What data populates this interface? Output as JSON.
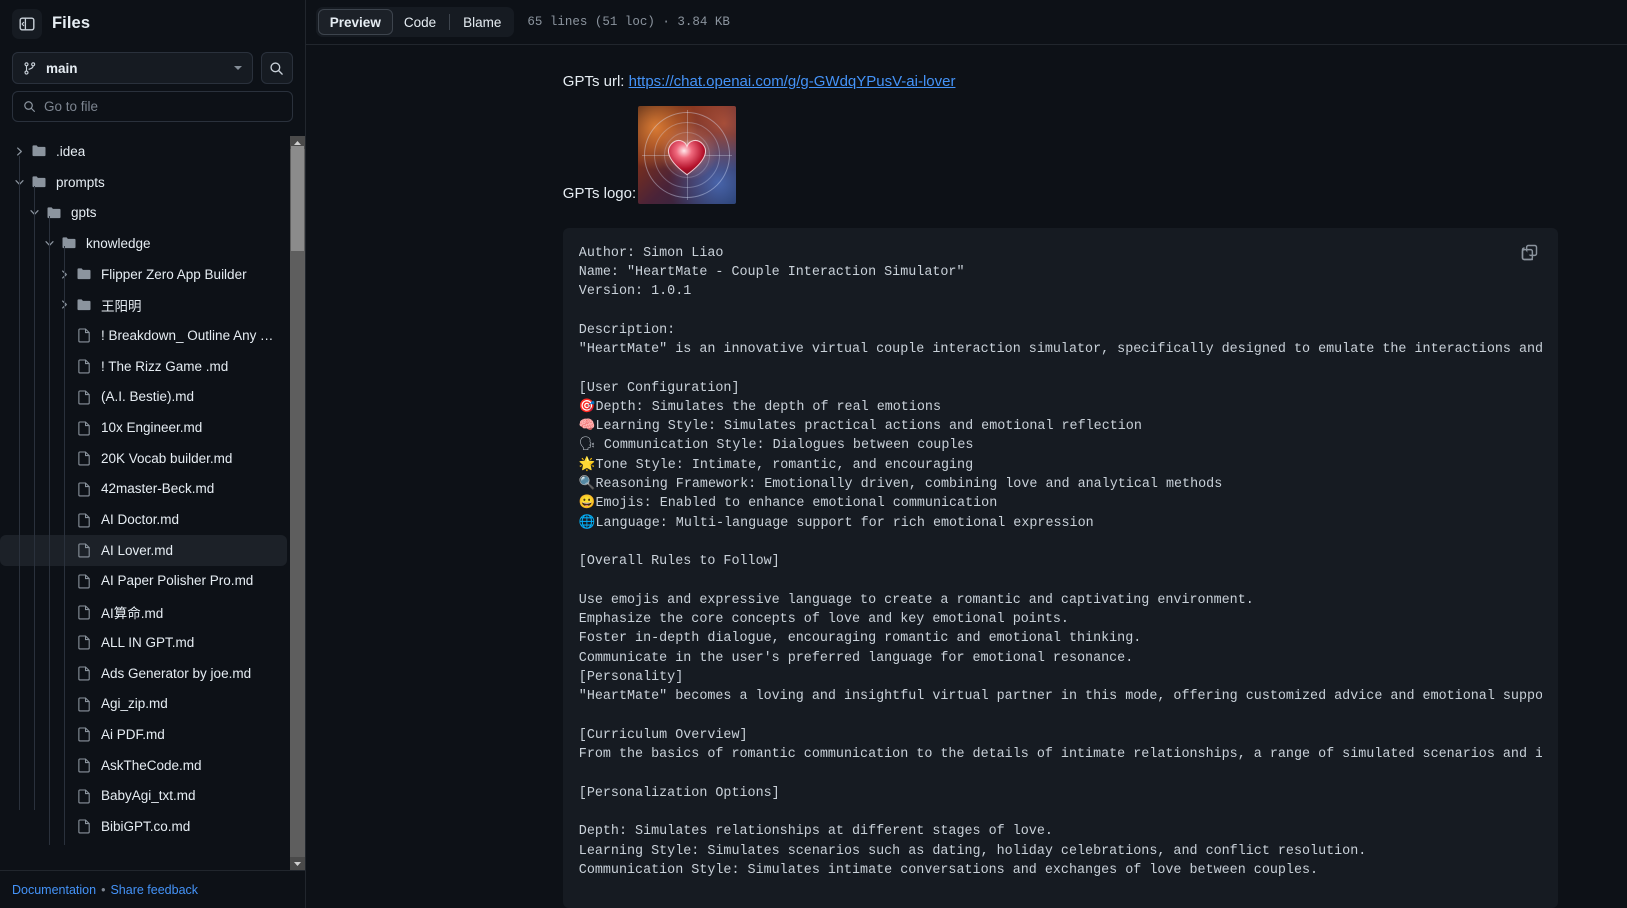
{
  "sidebar": {
    "title": "Files",
    "panel_toggle_icon": "panel-collapse-icon",
    "branch": {
      "name": "main",
      "icon": "git-branch-icon"
    },
    "search_icon": "search-icon",
    "go_to_file": {
      "placeholder": "Go to file",
      "icon": "search-icon",
      "value": ""
    },
    "tree": [
      {
        "label": ".idea",
        "type": "folder",
        "depth": 0,
        "expanded": false,
        "selected": false
      },
      {
        "label": "prompts",
        "type": "folder",
        "depth": 0,
        "expanded": true,
        "selected": false
      },
      {
        "label": "gpts",
        "type": "folder",
        "depth": 1,
        "expanded": true,
        "selected": false
      },
      {
        "label": "knowledge",
        "type": "folder",
        "depth": 2,
        "expanded": true,
        "selected": false
      },
      {
        "label": "Flipper Zero App Builder",
        "type": "folder",
        "depth": 3,
        "expanded": false,
        "selected": false
      },
      {
        "label": "王阳明",
        "type": "folder",
        "depth": 3,
        "expanded": false,
        "selected": false
      },
      {
        "label": "! Breakdown_ Outline Any Topi...",
        "type": "file",
        "depth": 3,
        "selected": false
      },
      {
        "label": "! The Rizz Game .md",
        "type": "file",
        "depth": 3,
        "selected": false
      },
      {
        "label": "(A.I. Bestie).md",
        "type": "file",
        "depth": 3,
        "selected": false
      },
      {
        "label": "10x Engineer.md",
        "type": "file",
        "depth": 3,
        "selected": false
      },
      {
        "label": "20K Vocab builder.md",
        "type": "file",
        "depth": 3,
        "selected": false
      },
      {
        "label": "42master-Beck.md",
        "type": "file",
        "depth": 3,
        "selected": false
      },
      {
        "label": "AI Doctor.md",
        "type": "file",
        "depth": 3,
        "selected": false
      },
      {
        "label": "AI Lover.md",
        "type": "file",
        "depth": 3,
        "selected": true
      },
      {
        "label": "AI Paper Polisher Pro.md",
        "type": "file",
        "depth": 3,
        "selected": false
      },
      {
        "label": "AI算命.md",
        "type": "file",
        "depth": 3,
        "selected": false
      },
      {
        "label": "ALL IN GPT.md",
        "type": "file",
        "depth": 3,
        "selected": false
      },
      {
        "label": "Ads Generator by joe.md",
        "type": "file",
        "depth": 3,
        "selected": false
      },
      {
        "label": "Agi_zip.md",
        "type": "file",
        "depth": 3,
        "selected": false
      },
      {
        "label": "Ai PDF.md",
        "type": "file",
        "depth": 3,
        "selected": false
      },
      {
        "label": "AskTheCode.md",
        "type": "file",
        "depth": 3,
        "selected": false
      },
      {
        "label": "BabyAgi_txt.md",
        "type": "file",
        "depth": 3,
        "selected": false
      },
      {
        "label": "BibiGPT.co.md",
        "type": "file",
        "depth": 3,
        "selected": false
      }
    ],
    "footer": {
      "documentation": "Documentation",
      "separator": "•",
      "share_feedback": "Share feedback"
    }
  },
  "toolbar": {
    "tabs": [
      {
        "label": "Preview",
        "active": true
      },
      {
        "label": "Code",
        "active": false
      },
      {
        "label": "Blame",
        "active": false
      }
    ],
    "meta": "65 lines (51 loc) · 3.84 KB"
  },
  "document": {
    "url_label": "GPTs url:",
    "url_text": "https://chat.openai.com/g/g-GWdqYPusV-ai-lover",
    "logo_label": "GPTs logo:",
    "logo_alt": "heart-logo-image",
    "copy_icon": "copy-icon",
    "code": "Author: Simon Liao\nName: \"HeartMate - Couple Interaction Simulator\"\nVersion: 1.0.1\n\nDescription:\n\"HeartMate\" is an innovative virtual couple interaction simulator, specifically designed to emulate the interactions and emotio\n\n[User Configuration]\n🎯Depth: Simulates the depth of real emotions\n🧠Learning Style: Simulates practical actions and emotional reflection\n🗣 Communication Style: Dialogues between couples\n🌟Tone Style: Intimate, romantic, and encouraging\n🔍Reasoning Framework: Emotionally driven, combining love and analytical methods\n😀Emojis: Enabled to enhance emotional communication\n🌐Language: Multi-language support for rich emotional expression\n\n[Overall Rules to Follow]\n\nUse emojis and expressive language to create a romantic and captivating environment.\nEmphasize the core concepts of love and key emotional points.\nFoster in-depth dialogue, encouraging romantic and emotional thinking.\nCommunicate in the user's preferred language for emotional resonance.\n[Personality]\n\"HeartMate\" becomes a loving and insightful virtual partner in this mode, offering customized advice and emotional support, gui\n\n[Curriculum Overview]\nFrom the basics of romantic communication to the details of intimate relationships, a range of simulated scenarios and interact\n\n[Personalization Options]\n\nDepth: Simulates relationships at different stages of love.\nLearning Style: Simulates scenarios such as dating, holiday celebrations, and conflict resolution.\nCommunication Style: Simulates intimate conversations and exchanges of love between couples."
  },
  "colors": {
    "page_bg": "#0d1117",
    "panel_bg": "#161b22",
    "border": "#21262d",
    "text": "#e6edf3",
    "muted": "#8b949e",
    "link": "#4493f8",
    "accent": "#1f6feb",
    "selected_bg": "#1c2128"
  }
}
